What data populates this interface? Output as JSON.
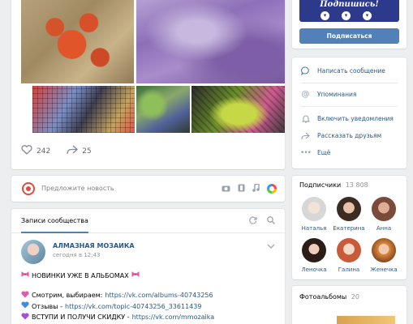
{
  "post": {
    "likes": "242",
    "shares": "25"
  },
  "suggest": {
    "placeholder": "Предложите новость"
  },
  "wall": {
    "tab_label": "Записи сообщества",
    "author": "АЛМАЗНАЯ МОЗАИКА",
    "time": "сегодня в 12:43",
    "line1": "НОВИНКИ УЖЕ В АЛЬБОМАХ",
    "line2_text": "Смотрим, выбираем: ",
    "line2_link": "https://vk.com/albums-40743256",
    "line3_text": "Отзывы - ",
    "line3_link": "https://vk.com/topic-40743256_33611439",
    "line4_text": "ВСТУПИ И ПОЛУЧИ СКИДКУ - ",
    "line4_link": "https://vk.com/mmozaika"
  },
  "promo": {
    "banner_text": "Подпишись!",
    "subscribe_label": "Подписаться"
  },
  "actions": {
    "message": "Написать сообщение",
    "mentions": "Упоминания",
    "notifications": "Включить уведомления",
    "share": "Рассказать друзьям",
    "more": "Ещё"
  },
  "subscribers": {
    "title": "Подписчики",
    "count": "13 808",
    "people": [
      "Наталья",
      "Екатерина",
      "Анна",
      "Леночка",
      "Галина",
      "Женечка"
    ]
  },
  "albums": {
    "title": "Фотоальбомы",
    "count": "20"
  },
  "colors": {
    "accent": "#5181b8",
    "link": "#2a5885",
    "background": "#edeef0",
    "promo_banner": "#2d3a8c",
    "heart_pink": "#e05aa8",
    "heart_blue": "#3d8ee0",
    "heart_purple": "#a24fe0"
  }
}
